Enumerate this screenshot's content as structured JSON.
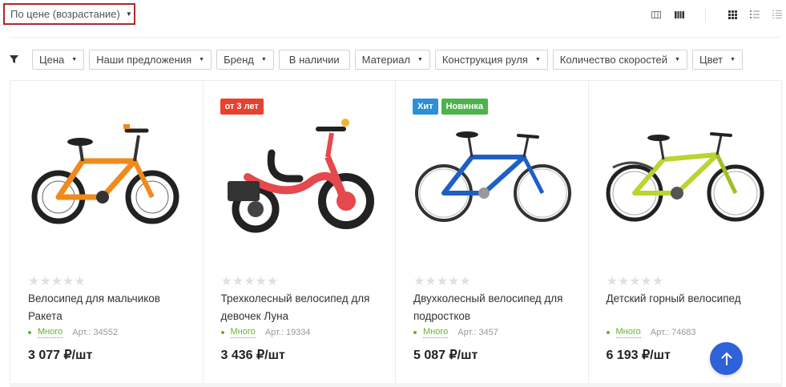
{
  "sort": {
    "label": "По цене (возрастание)"
  },
  "view_icons": [
    "table-view-icon",
    "table-compact-view-icon",
    "grid-view-icon",
    "list-view-icon",
    "price-list-view-icon"
  ],
  "filters": [
    {
      "label": "Цена",
      "has_caret": true
    },
    {
      "label": "Наши предложения",
      "has_caret": true
    },
    {
      "label": "Бренд",
      "has_caret": true
    },
    {
      "label": "В наличии",
      "has_caret": false
    },
    {
      "label": "Материал",
      "has_caret": true
    },
    {
      "label": "Конструкция руля",
      "has_caret": true
    },
    {
      "label": "Количество скоростей",
      "has_caret": true
    },
    {
      "label": "Цвет",
      "has_caret": true
    }
  ],
  "colors": {
    "accent_red": "#b0262b",
    "stock_green": "#65b32e",
    "badge_red": "#e8412d",
    "badge_blue": "#2d8fd6",
    "badge_green": "#4db34a",
    "up_button": "#2e62d9"
  },
  "products": [
    {
      "badges": [],
      "image": "orange-kids-bicycle",
      "title": "Велосипед для мальчиков Ракета",
      "rating": 0,
      "stock": "Много",
      "article": "Арт.: 34552",
      "price": "3 077 ₽/шт"
    },
    {
      "badges": [
        {
          "text": "от 3 лет",
          "color": "#e8412d"
        }
      ],
      "image": "red-tricycle",
      "title": "Трехколесный велосипед для девочек Луна",
      "rating": 0,
      "stock": "Много",
      "article": "Арт.: 19334",
      "price": "3 436 ₽/шт"
    },
    {
      "badges": [
        {
          "text": "Хит",
          "color": "#2d8fd6"
        },
        {
          "text": "Новинка",
          "color": "#4db34a"
        }
      ],
      "image": "blue-teen-bicycle",
      "title": "Двухколесный велосипед для подростков",
      "rating": 0,
      "stock": "Много",
      "article": "Арт.: 3457",
      "price": "5 087 ₽/шт"
    },
    {
      "badges": [],
      "image": "lime-mountain-bicycle",
      "title": "Детский горный велосипед",
      "rating": 0,
      "stock": "Много",
      "article": "Арт.: 74683",
      "price": "6 193 ₽/шт"
    }
  ],
  "scroll_up": {
    "icon": "arrow-up-icon"
  }
}
